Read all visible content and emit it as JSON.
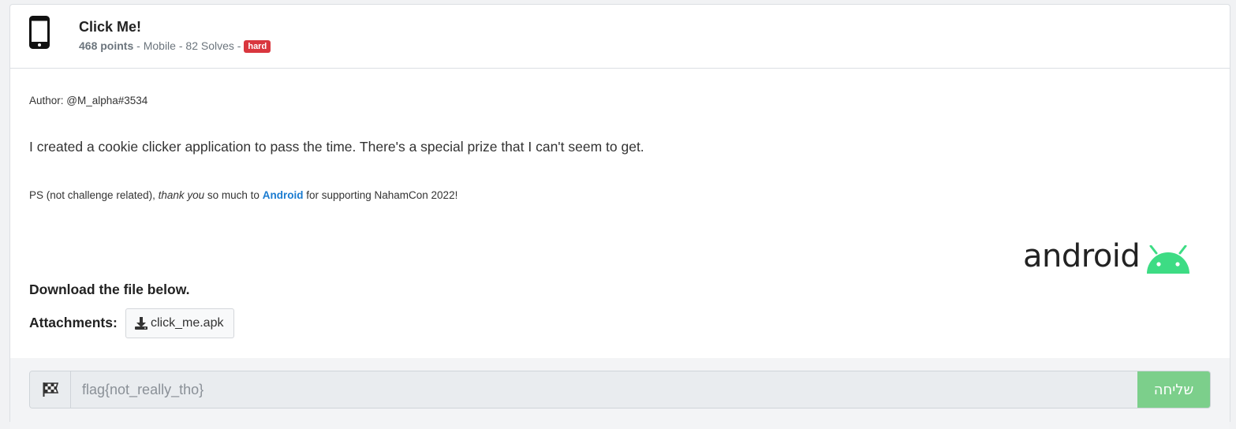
{
  "challenge": {
    "title": "Click Me!",
    "points": "468 points",
    "sep1": " - ",
    "category": "Mobile",
    "sep2": " - ",
    "solves": "82 Solves",
    "sep3": " - ",
    "difficulty": "hard",
    "difficulty_color": "#d9363e",
    "icon": "mobile-phone-icon"
  },
  "description": {
    "author": "Author: @M_alpha#3534",
    "text": "I created a cookie clicker application to pass the time. There's a special prize that I can't seem to get.",
    "ps_prefix": "PS (not challenge related), ",
    "ps_em": "thank you",
    "ps_middle": " so much to ",
    "ps_link": "Android",
    "ps_suffix": " for supporting NahamCon 2022!",
    "logo_text": "android",
    "download_text": "Download the file below."
  },
  "attachments": {
    "label": "Attachments:",
    "file": "click_me.apk",
    "icon": "download-icon"
  },
  "flag_form": {
    "icon": "checkered-flag-icon",
    "placeholder": "flag{not_really_tho}",
    "value": "",
    "submit_label": "שליחה",
    "submit_color": "#7ccf8b"
  }
}
